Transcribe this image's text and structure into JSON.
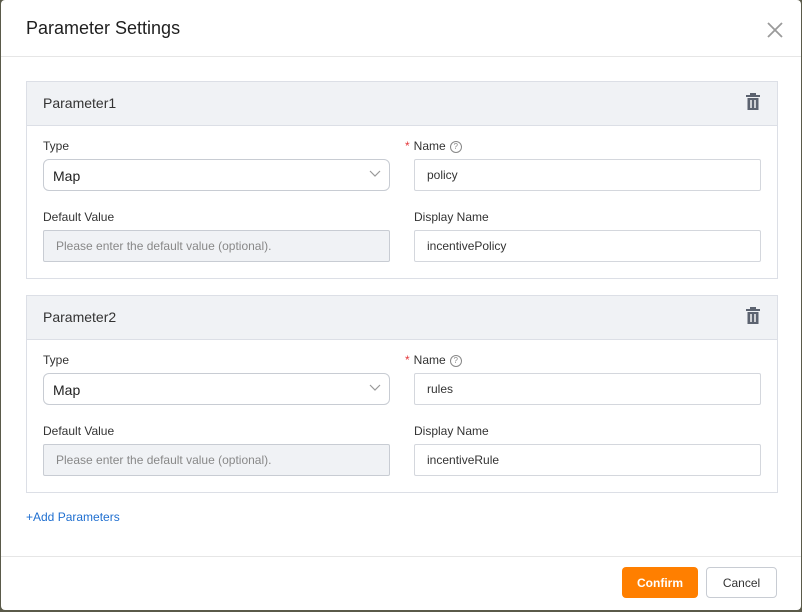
{
  "dialog": {
    "title": "Parameter Settings",
    "close_icon": "close-icon",
    "add_label": "+Add Parameters",
    "confirm_label": "Confirm",
    "cancel_label": "Cancel"
  },
  "colors": {
    "accent": "#ff7f00",
    "link": "#1f6fd0",
    "required": "#e4393c",
    "panel_header": "#f0f2f5"
  },
  "params": [
    {
      "title": "Parameter1",
      "type_label": "Type",
      "type_value": "Map",
      "name_label": "Name",
      "name_value": "policy",
      "default_label": "Default Value",
      "default_placeholder": "Please enter the default value (optional).",
      "display_label": "Display Name",
      "display_value": "incentivePolicy"
    },
    {
      "title": "Parameter2",
      "type_label": "Type",
      "type_value": "Map",
      "name_label": "Name",
      "name_value": "rules",
      "default_label": "Default Value",
      "default_placeholder": "Please enter the default value (optional).",
      "display_label": "Display Name",
      "display_value": "incentiveRule"
    }
  ]
}
